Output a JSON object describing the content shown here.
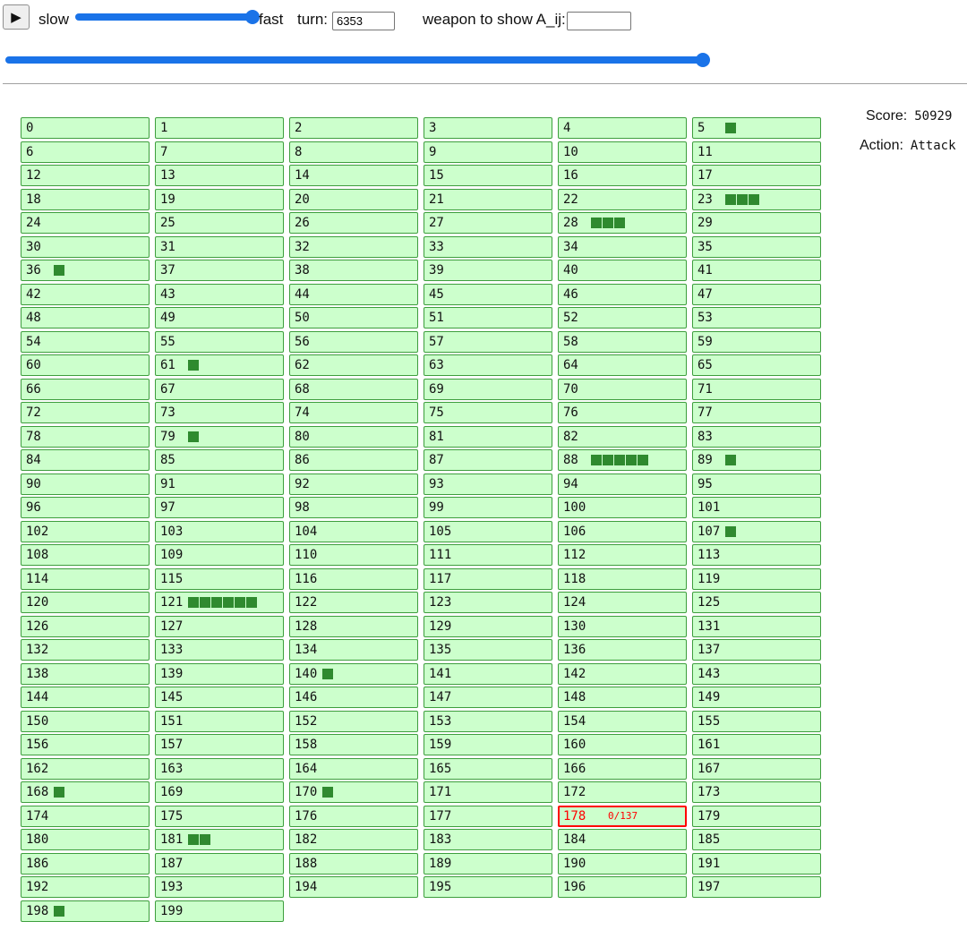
{
  "controls": {
    "play_icon": "play-icon",
    "play_symbol": "▶",
    "speed_slow_label": "slow",
    "speed_fast_label": "fast",
    "speed_level": 1.0,
    "turn_label": "turn:",
    "turn_value": "6353",
    "weapon_label": "weapon to show A_ij:",
    "weapon_value": "",
    "turn_slider_level": 1.0
  },
  "side": {
    "score_label": "Score:",
    "score_value": "50929",
    "action_label": "Action:",
    "action_value": "Attack"
  },
  "grid": {
    "cell_count": 200,
    "columns": 6,
    "weapons": {
      "5": 1,
      "23": 3,
      "28": 3,
      "36": 1,
      "61": 1,
      "79": 1,
      "88": 5,
      "89": 1,
      "107": 1,
      "121": 6,
      "140": 1,
      "168": 1,
      "170": 1,
      "181": 2,
      "198": 1
    },
    "selected": {
      "index": 178,
      "hp_text": "0/137"
    }
  },
  "colors": {
    "cell_bg": "#ccffcc",
    "cell_border": "#3d9e3d",
    "weapon_square": "#2f8a2f",
    "selected": "#ff0000",
    "accent": "#1a73e8"
  }
}
